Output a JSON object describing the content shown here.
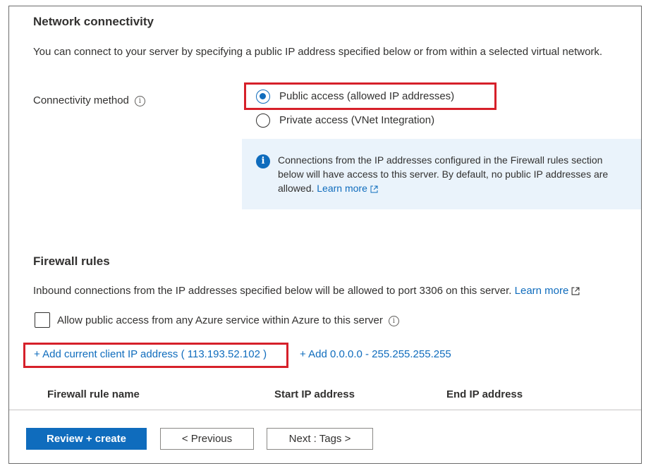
{
  "network": {
    "title": "Network connectivity",
    "description": "You can connect to your server by specifying a public IP address specified below or from within a selected virtual network.",
    "method_label": "Connectivity method",
    "options": [
      {
        "label": "Public access (allowed IP addresses)",
        "selected": true
      },
      {
        "label": "Private access (VNet Integration)",
        "selected": false
      }
    ],
    "info_text": "Connections from the IP addresses configured in the Firewall rules section below will have access to this server. By default, no public IP addresses are allowed.",
    "info_link": "Learn more"
  },
  "firewall": {
    "title": "Firewall rules",
    "description": "Inbound connections from the IP addresses specified below will be allowed to port 3306 on this server.",
    "learn_more": "Learn more",
    "allow_azure_label": "Allow public access from any Azure service within Azure to this server",
    "allow_azure_checked": false,
    "add_client_ip": "+ Add current client IP address ( 113.193.52.102 )",
    "add_all_range": "+ Add 0.0.0.0 - 255.255.255.255",
    "columns": [
      "Firewall rule name",
      "Start IP address",
      "End IP address"
    ]
  },
  "footer": {
    "review_create": "Review + create",
    "previous": "< Previous",
    "next": "Next : Tags >"
  },
  "colors": {
    "accent": "#0f6cbd",
    "highlight": "#d6202a",
    "info_bg": "#eaf3fb"
  }
}
